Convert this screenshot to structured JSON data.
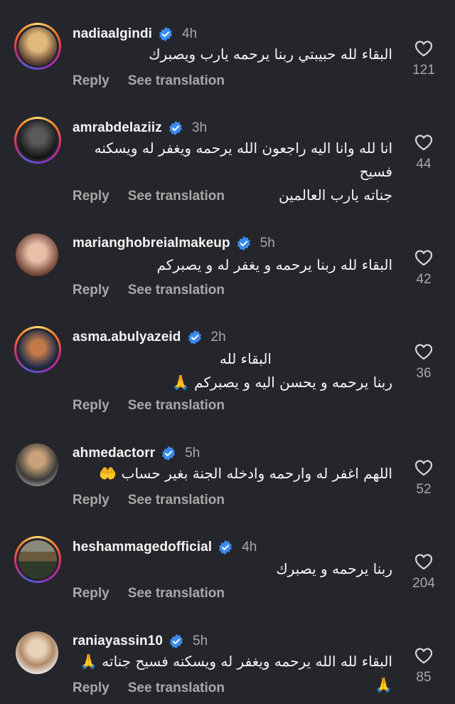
{
  "actions": {
    "reply": "Reply",
    "translate": "See translation"
  },
  "colors": {
    "background": "#25262b",
    "verified": "#3b8bef",
    "muted": "#a8a8a8"
  },
  "comments": [
    {
      "username": "nadiaalgindi",
      "time": "4h",
      "lines": [
        "البقاء لله حبيبتي ربنا يرحمه يارب ويصبرك"
      ],
      "likes": "121",
      "ring": "story",
      "avatar_colors": [
        "#c9a46a",
        "#3b3024"
      ]
    },
    {
      "username": "amrabdelaziiz",
      "time": "3h",
      "lines": [
        "انا لله وانا اليه راجعون الله يرحمه ويغفر له ويسكنه فسيح",
        "جناته يارب العالمين"
      ],
      "likes": "44",
      "ring": "story",
      "avatar_colors": [
        "#222222",
        "#6a6a6a"
      ]
    },
    {
      "username": "marianghobreialmakeup",
      "time": "5h",
      "lines": [
        "البقاء لله ربنا يرحمه و يغفر له و يصبركم"
      ],
      "likes": "42",
      "ring": "plain",
      "avatar_colors": [
        "#8a5c4a",
        "#e8c0a8"
      ]
    },
    {
      "username": "asma.abulyazeid",
      "time": "2h",
      "lines": [
        "البقاء لله",
        "ربنا يرحمه و يحسن اليه و يصبركم 🙏"
      ],
      "likes": "36",
      "ring": "story",
      "avatar_colors": [
        "#1b2a4a",
        "#c27a4a"
      ]
    },
    {
      "username": "ahmedactorr",
      "time": "5h",
      "lines": [
        "اللهم اغفر له وارحمه وادخله الجنة بغير حساب 🤲"
      ],
      "likes": "52",
      "ring": "plain",
      "avatar_colors": [
        "#3a3a3a",
        "#c9a27a"
      ]
    },
    {
      "username": "heshammagedofficial",
      "time": "4h",
      "lines": [
        "ربنا يرحمه و يصبرك"
      ],
      "likes": "204",
      "ring": "story",
      "avatar_colors": [
        "#6b5a3c",
        "#2f3a2a"
      ]
    },
    {
      "username": "raniayassin10",
      "time": "5h",
      "lines": [
        "البقاء لله الله يرحمه ويغفر له ويسكنه فسيح جناته 🙏 🙏"
      ],
      "likes": "85",
      "ring": "plain",
      "avatar_colors": [
        "#d8c2a6",
        "#5a4030"
      ]
    }
  ]
}
